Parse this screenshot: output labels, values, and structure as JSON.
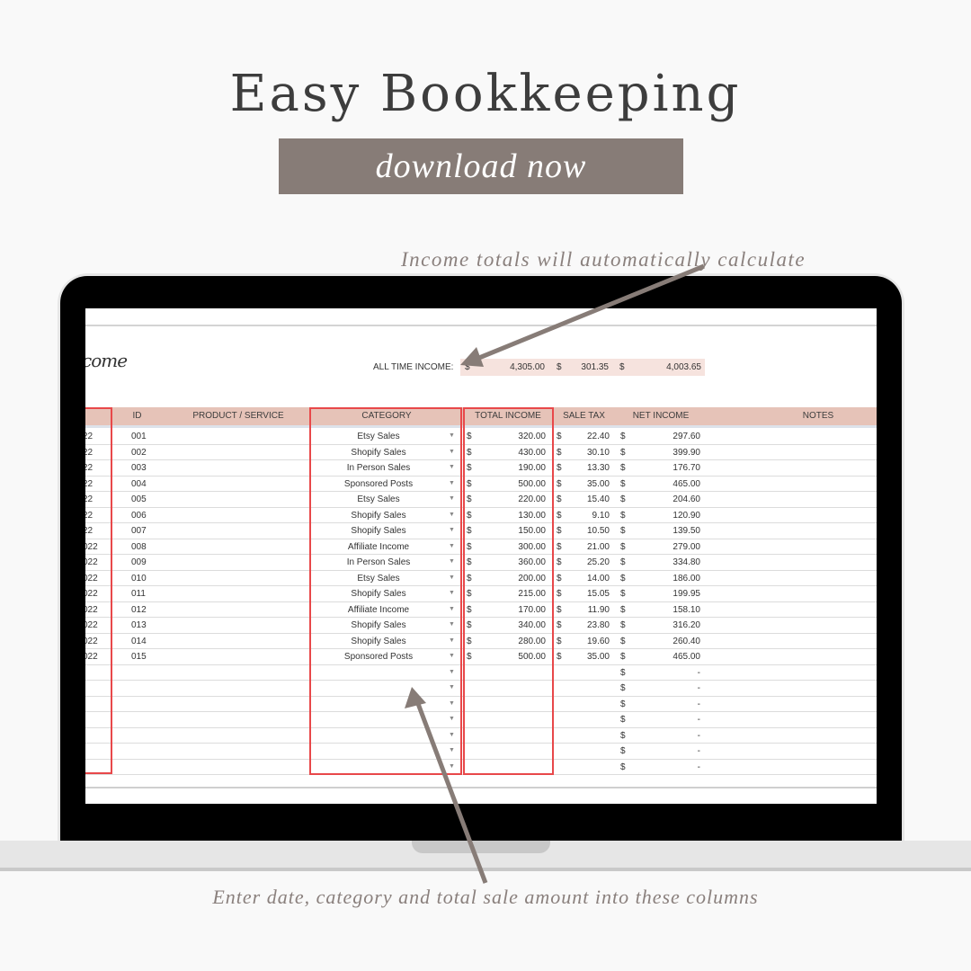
{
  "header": {
    "title": "Easy Bookkeeping",
    "cta_label": "download now"
  },
  "annotations": {
    "top": "Income totals will automatically calculate",
    "bottom": "Enter date, category and total sale amount into these columns"
  },
  "colors": {
    "background": "#f9f9f9",
    "cta": "#877c77",
    "header_row": "#e6c3b8",
    "totals_box": "#f6e3de",
    "highlight_box": "#e8484a",
    "annotation_text": "#8a807d"
  },
  "sheet": {
    "title_fragment": "come",
    "all_time": {
      "label": "ALL TIME INCOME:",
      "currency": "$",
      "total_income": "4,305.00",
      "sale_tax": "301.35",
      "net_income": "4,003.65"
    },
    "columns": [
      "ID",
      "PRODUCT / SERVICE",
      "CATEGORY",
      "TOTAL INCOME",
      "SALE TAX",
      "NET INCOME",
      "NOTES"
    ],
    "dropdown_icon": "triangle-down",
    "rows": [
      {
        "date": "22",
        "id": "001",
        "category": "Etsy Sales",
        "total": "320.00",
        "tax": "22.40",
        "net": "297.60"
      },
      {
        "date": "22",
        "id": "002",
        "category": "Shopify Sales",
        "total": "430.00",
        "tax": "30.10",
        "net": "399.90"
      },
      {
        "date": "22",
        "id": "003",
        "category": "In Person Sales",
        "total": "190.00",
        "tax": "13.30",
        "net": "176.70"
      },
      {
        "date": "22",
        "id": "004",
        "category": "Sponsored Posts",
        "total": "500.00",
        "tax": "35.00",
        "net": "465.00"
      },
      {
        "date": "22",
        "id": "005",
        "category": "Etsy Sales",
        "total": "220.00",
        "tax": "15.40",
        "net": "204.60"
      },
      {
        "date": "22",
        "id": "006",
        "category": "Shopify Sales",
        "total": "130.00",
        "tax": "9.10",
        "net": "120.90"
      },
      {
        "date": "22",
        "id": "007",
        "category": "Shopify Sales",
        "total": "150.00",
        "tax": "10.50",
        "net": "139.50"
      },
      {
        "date": "022",
        "id": "008",
        "category": "Affiliate Income",
        "total": "300.00",
        "tax": "21.00",
        "net": "279.00"
      },
      {
        "date": "022",
        "id": "009",
        "category": "In Person Sales",
        "total": "360.00",
        "tax": "25.20",
        "net": "334.80"
      },
      {
        "date": "022",
        "id": "010",
        "category": "Etsy Sales",
        "total": "200.00",
        "tax": "14.00",
        "net": "186.00"
      },
      {
        "date": "022",
        "id": "011",
        "category": "Shopify Sales",
        "total": "215.00",
        "tax": "15.05",
        "net": "199.95"
      },
      {
        "date": "022",
        "id": "012",
        "category": "Affiliate Income",
        "total": "170.00",
        "tax": "11.90",
        "net": "158.10"
      },
      {
        "date": "022",
        "id": "013",
        "category": "Shopify Sales",
        "total": "340.00",
        "tax": "23.80",
        "net": "316.20"
      },
      {
        "date": "022",
        "id": "014",
        "category": "Shopify Sales",
        "total": "280.00",
        "tax": "19.60",
        "net": "260.40"
      },
      {
        "date": "022",
        "id": "015",
        "category": "Sponsored Posts",
        "total": "500.00",
        "tax": "35.00",
        "net": "465.00"
      }
    ],
    "empty_rows": 7,
    "empty_net_placeholder": "-",
    "currency": "$"
  }
}
